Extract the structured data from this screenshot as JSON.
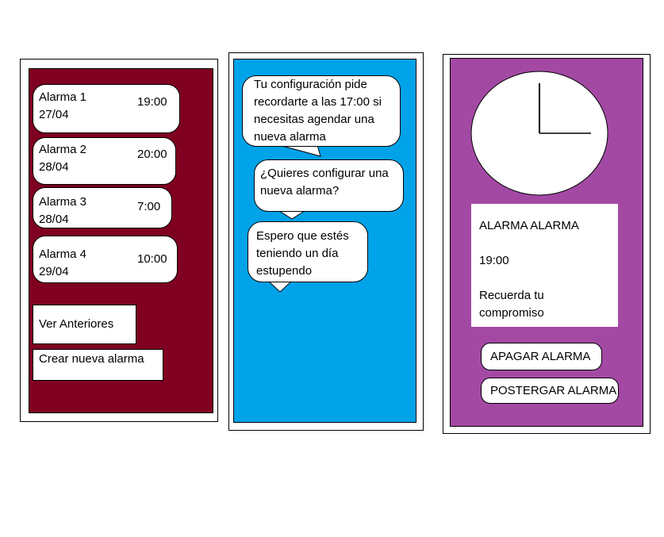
{
  "screen1": {
    "bg_color": "#7f0020",
    "alarms": [
      {
        "name": "Alarma 1",
        "date": "27/04",
        "time": "19:00"
      },
      {
        "name": "Alarma 2",
        "date": "28/04",
        "time": "20:00"
      },
      {
        "name": "Alarma 3",
        "date": "28/04",
        "time": "7:00"
      },
      {
        "name": "Alarma 4",
        "date": "29/04",
        "time": "10:00"
      }
    ],
    "view_previous_label": "Ver Anteriores",
    "create_alarm_label": "Crear nueva alarma"
  },
  "screen2": {
    "bg_color": "#00a2e8",
    "messages": [
      {
        "lines": [
          "Tu configuración pide",
          "recordarte a las 17:00 si",
          "necesitas agendar una",
          "nueva alarma"
        ]
      },
      {
        "lines": [
          "¿Quieres configurar una",
          "nueva alarma?"
        ]
      },
      {
        "lines": [
          "Espero que estés",
          "teniendo un día",
          "estupendo"
        ]
      }
    ]
  },
  "screen3": {
    "bg_color": "#a349a4",
    "clock_icon": "analog-clock-icon",
    "alert_title": "ALARMA ALARMA",
    "alert_time": "19:00",
    "alert_note_lines": [
      "Recuerda tu",
      "compromiso"
    ],
    "stop_label": "APAGAR ALARMA",
    "snooze_label": "POSTERGAR ALARMA"
  }
}
